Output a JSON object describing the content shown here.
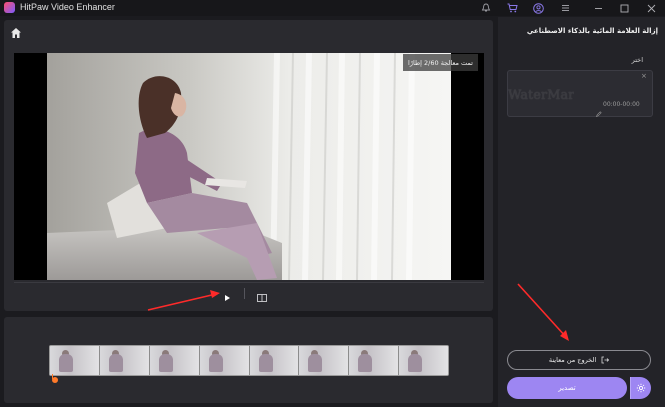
{
  "window": {
    "app_title": "HitPaw Video Enhancer",
    "title_icons": [
      "bell-icon",
      "cart-icon",
      "user-icon",
      "menu-icon",
      "minimize-icon",
      "maximize-icon",
      "close-icon"
    ]
  },
  "preview": {
    "overlay_text": "تمت معالجة 2/60 إطارًا",
    "controls": {
      "play_icon": "play-icon",
      "compare_icon": "compare-view-icon"
    }
  },
  "timeline": {
    "thumbnail_count": 8
  },
  "sidebar": {
    "title": "إزالة العلامة المائية بالذكاء الاصطناعي",
    "select_label": "اختر",
    "watermark_card": {
      "thumb_text": "WaterMark",
      "time_range": "00:00-00:00"
    },
    "exit_preview_label": "الخروج من معاينة",
    "export_label": "تصدير"
  },
  "colors": {
    "accent": "#9d86f2",
    "playhead": "#ff7a2a",
    "annotation_arrow": "#ff2a2a"
  }
}
